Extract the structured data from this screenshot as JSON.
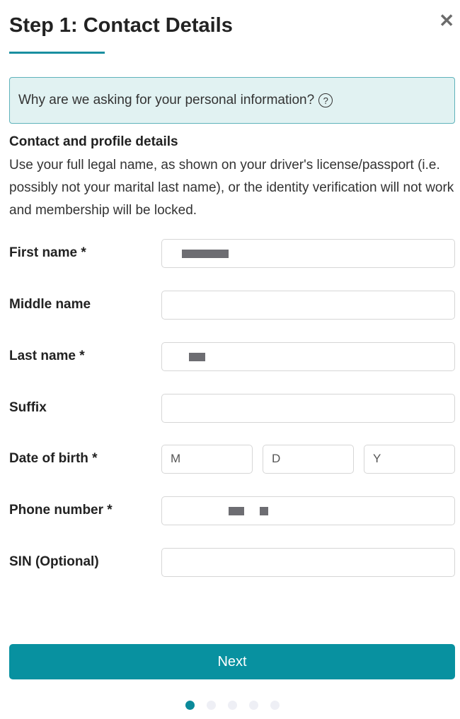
{
  "header": {
    "title": "Step 1: Contact Details",
    "close_icon": "close-icon"
  },
  "info_box": {
    "text": "Why are we asking for your personal information?",
    "icon": "question-circle-icon"
  },
  "section": {
    "heading": "Contact and profile details",
    "body": "Use your full legal name, as shown on your driver's license/passport (i.e. possibly not your marital last name), or the identity verification will not work and membership will be locked."
  },
  "form": {
    "first_name": {
      "label": "First name *"
    },
    "middle_name": {
      "label": "Middle name"
    },
    "last_name": {
      "label": "Last name *"
    },
    "suffix": {
      "label": "Suffix"
    },
    "dob": {
      "label": "Date of birth *",
      "month_placeholder": "M",
      "day_placeholder": "D",
      "year_placeholder": "Y"
    },
    "phone": {
      "label": "Phone number *"
    },
    "sin": {
      "label": "SIN (Optional)"
    }
  },
  "next_button": {
    "label": "Next"
  },
  "progress": {
    "current_step": 1,
    "total_steps": 5
  },
  "colors": {
    "accent": "#0891a0",
    "info_bg": "#e1f2f2"
  }
}
